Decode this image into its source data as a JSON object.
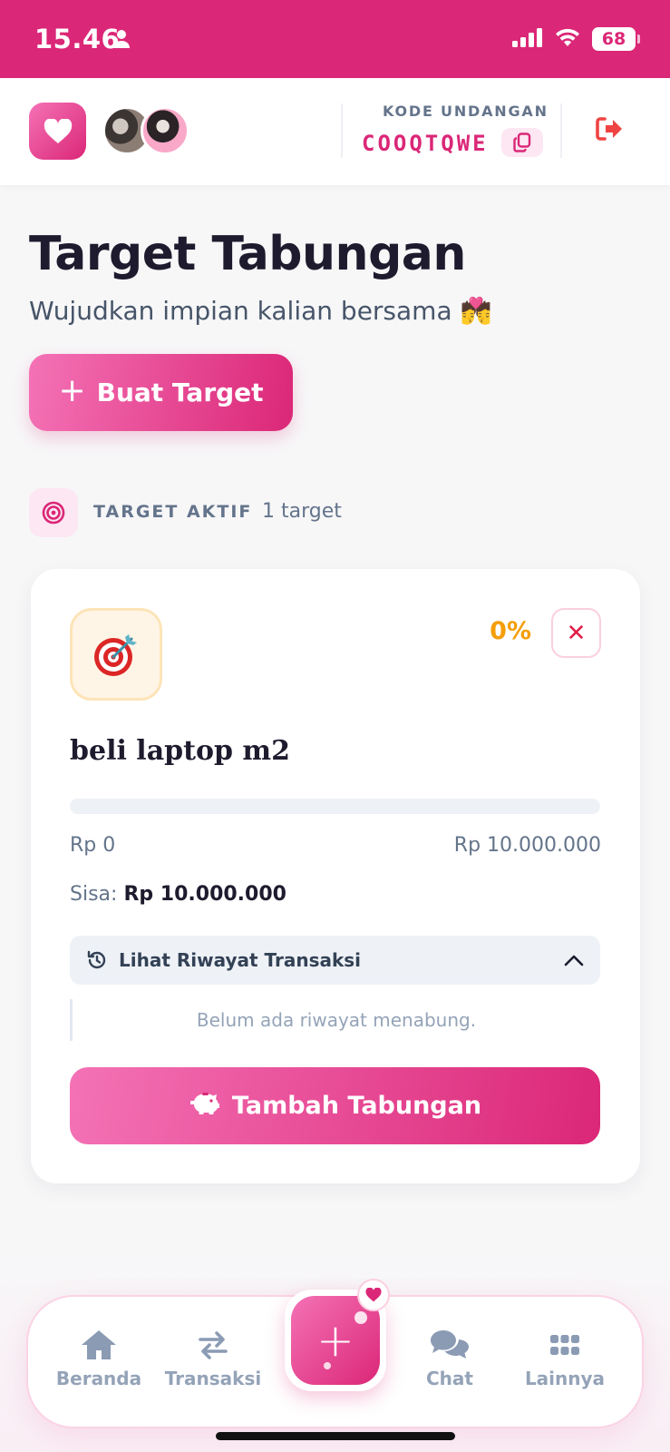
{
  "status_bar": {
    "time": "15.46",
    "battery": "68"
  },
  "header": {
    "invite_label": "KODE UNDANGAN",
    "invite_code": "COOQTQWE"
  },
  "main": {
    "title": "Target Tabungan",
    "subtitle": "Wujudkan impian kalian bersama 💏",
    "create_button": "Buat Target",
    "section_label": "TARGET AKTIF",
    "section_count": "1 target"
  },
  "goal": {
    "icon": "🎯",
    "name": "beli laptop m2",
    "percent": "0%",
    "progress_fraction": 0,
    "current_amount": "Rp 0",
    "target_amount": "Rp 10.000.000",
    "remaining_label": "Sisa:",
    "remaining_value": "Rp 10.000.000",
    "history_toggle": "Lihat Riwayat Transaksi",
    "history_empty": "Belum ada riwayat menabung.",
    "add_button": "Tambah Tabungan"
  },
  "bottom_nav": {
    "items": [
      {
        "label": "Beranda",
        "icon": "home-icon"
      },
      {
        "label": "Transaksi",
        "icon": "swap-arrows-icon"
      },
      {
        "label": "Chat",
        "icon": "chat-bubbles-icon"
      },
      {
        "label": "Lainnya",
        "icon": "grid-dots-icon"
      }
    ],
    "fab_icon": "plus-icon"
  },
  "colors": {
    "brand": "#db2777",
    "brand_light": "#f472b6",
    "accent_amber": "#f59e0b",
    "danger": "#e11d48"
  }
}
